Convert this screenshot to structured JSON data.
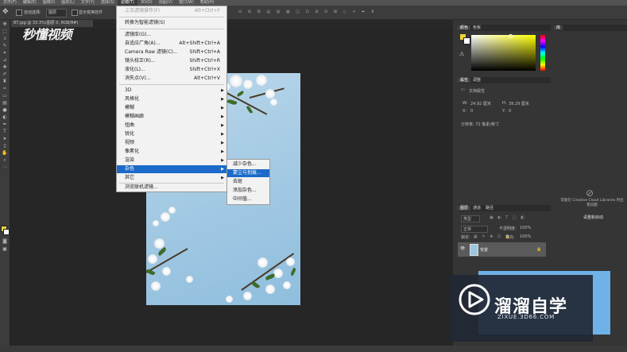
{
  "menubar": {
    "items": [
      {
        "label": "文件(F)"
      },
      {
        "label": "编辑(E)"
      },
      {
        "label": "图像(I)"
      },
      {
        "label": "图层(L)"
      },
      {
        "label": "文字(Y)"
      },
      {
        "label": "选择(S)"
      },
      {
        "label": "滤镜(T)"
      },
      {
        "label": "3D(D)"
      },
      {
        "label": "视图(V)"
      },
      {
        "label": "窗口(W)"
      },
      {
        "label": "帮助(H)"
      }
    ],
    "active_index": 6
  },
  "options": {
    "auto_select_label": "自动选择:",
    "auto_select_value": "图层",
    "show_transform_label": "显示变换控件"
  },
  "document": {
    "tab_label": "87.jpg @ 33.3%(图层 0, RGB/8#)"
  },
  "watermark": {
    "logo_text": "秒懂视频"
  },
  "filter_menu": {
    "items": [
      {
        "label": "上次滤镜操作(F)",
        "shortcut": "Alt+Ctrl+F",
        "disabled": true
      },
      {
        "label": "转换为智能滤镜(S)"
      },
      {
        "label": "滤镜库(G)..."
      },
      {
        "label": "自适应广角(A)...",
        "shortcut": "Alt+Shift+Ctrl+A"
      },
      {
        "label": "Camera Raw 滤镜(C)...",
        "shortcut": "Shift+Ctrl+A"
      },
      {
        "label": "镜头校正(R)...",
        "shortcut": "Shift+Ctrl+R"
      },
      {
        "label": "液化(L)...",
        "shortcut": "Shift+Ctrl+X"
      },
      {
        "label": "消失点(V)...",
        "shortcut": "Alt+Ctrl+V"
      },
      {
        "label": "3D",
        "submenu": true
      },
      {
        "label": "风格化",
        "submenu": true
      },
      {
        "label": "模糊",
        "submenu": true
      },
      {
        "label": "模糊画廊",
        "submenu": true
      },
      {
        "label": "扭曲",
        "submenu": true
      },
      {
        "label": "锐化",
        "submenu": true
      },
      {
        "label": "视频",
        "submenu": true
      },
      {
        "label": "像素化",
        "submenu": true
      },
      {
        "label": "渲染",
        "submenu": true
      },
      {
        "label": "杂色",
        "submenu": true,
        "highlighted": true
      },
      {
        "label": "其它",
        "submenu": true
      },
      {
        "label": "浏览联机滤镜..."
      }
    ]
  },
  "noise_submenu": {
    "items": [
      {
        "label": "减少杂色..."
      },
      {
        "label": "蒙尘与划痕...",
        "highlighted": true
      },
      {
        "label": "去斑"
      },
      {
        "label": "添加杂色..."
      },
      {
        "label": "中间值..."
      }
    ]
  },
  "panels": {
    "color_tabs": [
      "颜色",
      "色板"
    ],
    "learn_tab": "库",
    "properties_tabs": [
      "属性",
      "调整"
    ],
    "properties_title": "文档属性",
    "width_label": "W:",
    "width_value": "24.92 厘米",
    "height_label": "H:",
    "height_value": "39.29 厘米",
    "x_label": "X:",
    "x_value": "0",
    "y_label": "Y:",
    "y_value": "0",
    "resolution": "分辨率: 72 像素/英寸",
    "cc_message": "可能在 Creative Cloud Libraries 时出 错问题",
    "cc_link": "请重新启动",
    "layers_tabs": [
      "图层",
      "通道",
      "路径"
    ],
    "layer_kind": "类型",
    "blend_mode": "正常",
    "opacity_label": "不透明度:",
    "opacity_value": "100%",
    "lock_label": "锁定:",
    "fill_label": "填充:",
    "fill_value": "100%",
    "layer_name": "背景"
  },
  "brand": {
    "title": "溜溜自学",
    "url": "ZIXUE.3D66.COM"
  },
  "colors": {
    "foreground": "#f2d23a",
    "background": "#ffffff",
    "menu_highlight": "#1b6ac9"
  }
}
